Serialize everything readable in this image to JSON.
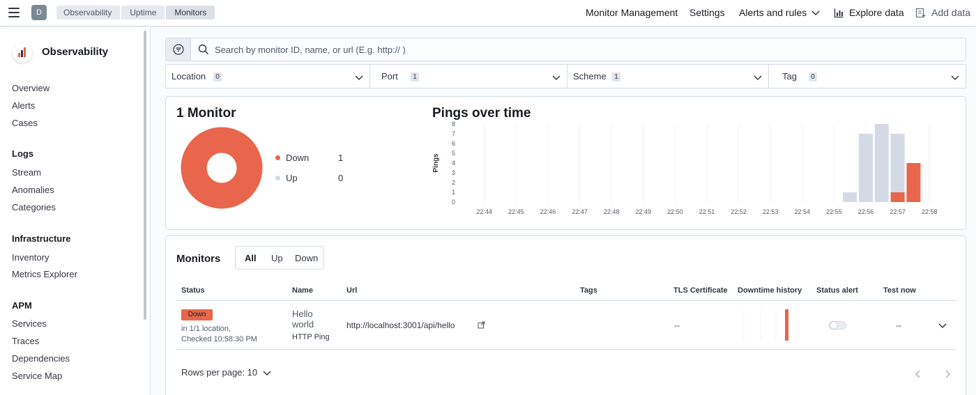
{
  "header": {
    "space_initial": "D",
    "breadcrumbs": [
      "Observability",
      "Uptime",
      "Monitors"
    ],
    "nav": {
      "monitor_management": "Monitor Management",
      "settings": "Settings",
      "alerts_and_rules": "Alerts and rules",
      "explore_data": "Explore data",
      "add_data": "Add data"
    }
  },
  "sidebar": {
    "title": "Observability",
    "top_items": [
      "Overview",
      "Alerts",
      "Cases"
    ],
    "sections": [
      {
        "title": "Logs",
        "items": [
          "Stream",
          "Anomalies",
          "Categories"
        ]
      },
      {
        "title": "Infrastructure",
        "items": [
          "Inventory",
          "Metrics Explorer"
        ]
      },
      {
        "title": "APM",
        "items": [
          "Services",
          "Traces",
          "Dependencies",
          "Service Map"
        ]
      }
    ]
  },
  "search": {
    "placeholder": "Search by monitor ID, name, or url (E.g. http:// )"
  },
  "filters": [
    {
      "label": "Location",
      "count": "0"
    },
    {
      "label": "Port",
      "count": "1"
    },
    {
      "label": "Scheme",
      "count": "1"
    },
    {
      "label": "Tag",
      "count": "0"
    }
  ],
  "summary": {
    "title": "1 Monitor",
    "legend": [
      {
        "label": "Down",
        "value": "1",
        "color": "#e7664c"
      },
      {
        "label": "Up",
        "value": "0",
        "color": "#d3dae6"
      }
    ]
  },
  "pings": {
    "title": "Pings over time"
  },
  "chart_data": {
    "type": "bar",
    "title": "Pings over time",
    "ylabel": "Pings",
    "xlabel": "",
    "ylim": [
      0,
      8
    ],
    "yticks": [
      "0",
      "1",
      "2",
      "3",
      "4",
      "5",
      "6",
      "7",
      "8"
    ],
    "categories": [
      "22:44",
      "22:45",
      "22:46",
      "22:47",
      "22:48",
      "22:49",
      "22:50",
      "22:51",
      "22:52",
      "22:53",
      "22:54",
      "22:55",
      "22:56",
      "22:57",
      "22:58"
    ],
    "slots": [
      "22:55:30",
      "22:56",
      "22:56:30",
      "22:57",
      "22:57:30",
      "22:58"
    ],
    "series": [
      {
        "name": "Up",
        "color": "#d3dae6",
        "values": [
          1,
          7,
          8,
          6,
          0,
          0
        ]
      },
      {
        "name": "Down",
        "color": "#e7664c",
        "values": [
          0,
          0,
          0,
          1,
          4,
          0
        ]
      }
    ],
    "grid": true,
    "stacked": true
  },
  "monitors": {
    "title": "Monitors",
    "tabs": [
      "All",
      "Up",
      "Down"
    ],
    "columns": [
      "Status",
      "Name",
      "Url",
      "Tags",
      "TLS Certificate",
      "Downtime history",
      "Status alert",
      "Test now"
    ],
    "rows": [
      {
        "status": "Down",
        "status_location": "in 1/1 location,",
        "status_checked": "Checked 10:58:30 PM",
        "name_line1": "Hello",
        "name_line2": "world",
        "type": "HTTP Ping",
        "url": "http://localhost:3001/api/hello",
        "tls": "--",
        "test_now": "--"
      }
    ],
    "rows_per_page": "Rows per page: 10"
  }
}
